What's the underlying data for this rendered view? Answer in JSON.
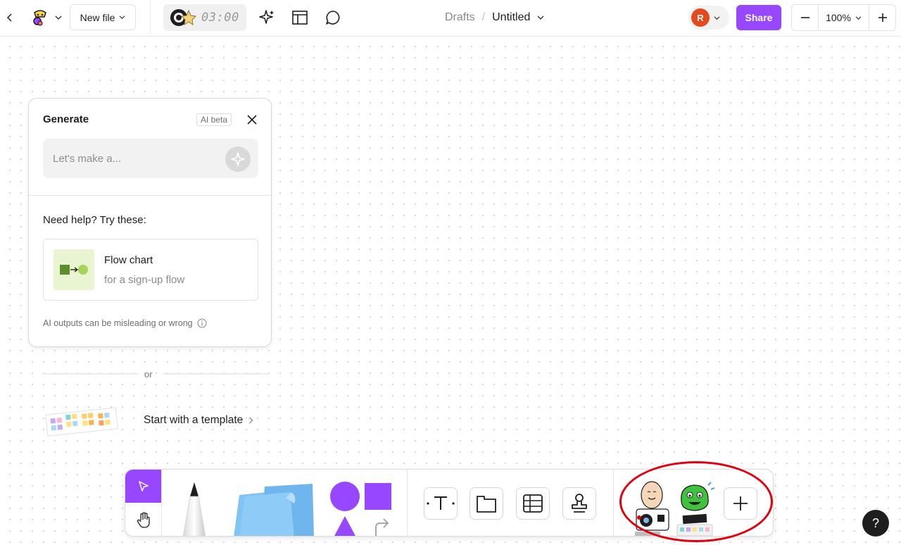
{
  "topbar": {
    "new_file_label": "New file",
    "timer": "03:00",
    "breadcrumb": {
      "folder": "Drafts",
      "separator": "/",
      "title": "Untitled"
    },
    "avatar_initial": "R",
    "share_label": "Share",
    "zoom_level": "100%",
    "icons": [
      "back-chevron-icon",
      "figjam-logo-icon",
      "chevron-down-icon",
      "timer-icon",
      "ai-sparkle-icon",
      "layout-icon",
      "comment-icon",
      "minus-icon",
      "plus-icon"
    ]
  },
  "generate_panel": {
    "title": "Generate",
    "badge": "AI beta",
    "input_placeholder": "Let's make a...",
    "help_title": "Need help? Try these:",
    "suggestion": {
      "title": "Flow chart",
      "subtitle": "for a sign-up flow"
    },
    "disclaimer": "AI outputs can be misleading or wrong"
  },
  "divider_text": "or",
  "template_link": "Start with a template",
  "toolbar": {
    "tools": [
      "move",
      "hand",
      "pen",
      "sticky-note",
      "shapes",
      "text",
      "section",
      "table",
      "stamp",
      "sticker",
      "sticker-pack",
      "add-widget"
    ]
  },
  "help_label": "?",
  "colors": {
    "accent": "#9747ff",
    "avatar": "#e44a1e",
    "annotation_ring": "#e3000f",
    "flowchart_green": "#5f8d2e",
    "sticky_blue": "#80c3f5"
  }
}
